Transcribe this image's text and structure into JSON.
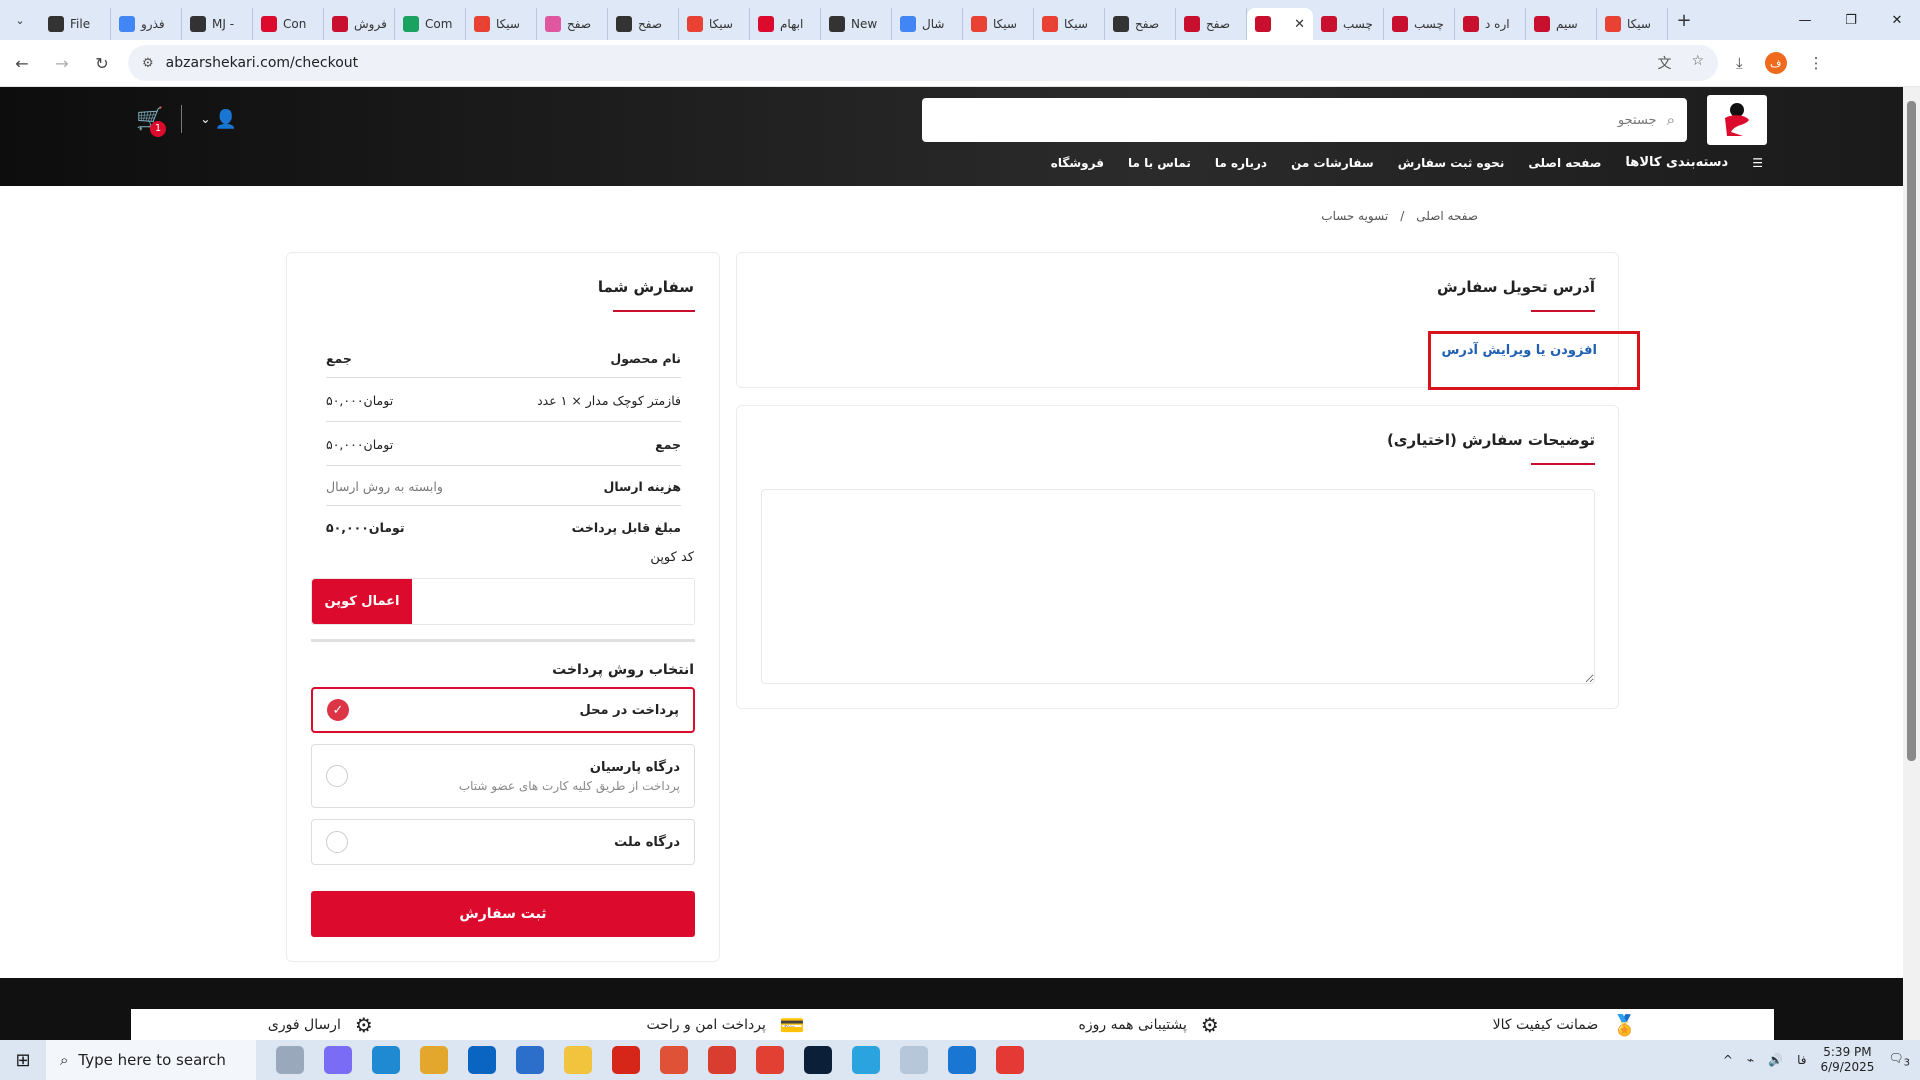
{
  "browser": {
    "tabs": [
      {
        "label": "File",
        "color": "#333333"
      },
      {
        "label": "فذرو",
        "color": "#4285f4"
      },
      {
        "label": "MJ -",
        "color": "#333333"
      },
      {
        "label": "Con",
        "color": "#dc0a2d"
      },
      {
        "label": "فروش",
        "color": "#c8102e"
      },
      {
        "label": "Com",
        "color": "#1aa260"
      },
      {
        "label": "سیکا",
        "color": "#e94235"
      },
      {
        "label": "صفح",
        "color": "#e056a0"
      },
      {
        "label": "صفح",
        "color": "#333333"
      },
      {
        "label": "سیکا",
        "color": "#e94235"
      },
      {
        "label": "ابهام",
        "color": "#dc0a2d"
      },
      {
        "label": "New",
        "color": "#333333"
      },
      {
        "label": "شال",
        "color": "#4285f4"
      },
      {
        "label": "سیکا",
        "color": "#e94235"
      },
      {
        "label": "سیکا",
        "color": "#e94235"
      },
      {
        "label": "صفح",
        "color": "#333333"
      },
      {
        "label": "صفح",
        "color": "#c8102e"
      },
      {
        "label": "",
        "color": "#c8102e",
        "active": true
      },
      {
        "label": "چسب",
        "color": "#c8102e"
      },
      {
        "label": "چسب",
        "color": "#c8102e"
      },
      {
        "label": "اره د",
        "color": "#c8102e"
      },
      {
        "label": "سیم",
        "color": "#c8102e"
      },
      {
        "label": "سیکا",
        "color": "#e94235"
      }
    ],
    "url": "abzarshekari.com/checkout",
    "profile_initial": "ف"
  },
  "site": {
    "search_placeholder": "جستجو",
    "cart_count": "1",
    "menu": {
      "categories": "دسته‌بندی کالاها",
      "items": [
        "صفحه اصلی",
        "نحوه ثبت سفارش",
        "سفارشات من",
        "درباره ما",
        "تماس با ما",
        "فروشگاه"
      ]
    },
    "breadcrumb": {
      "home": "صفحه اصلی",
      "sep": "/",
      "current": "تسویه حساب"
    }
  },
  "address": {
    "title": "آدرس تحویل سفارش",
    "link": "افزودن یا ویرایش آدرس"
  },
  "notes": {
    "title": "توضیحات سفارش (اختیاری)"
  },
  "order": {
    "title": "سفارش شما",
    "header": {
      "product": "نام محصول",
      "total": "جمع"
    },
    "item": {
      "name": "فازمتر کوچک مدار × ۱ عدد",
      "price": "تومان۵۰,۰۰۰"
    },
    "subtotal": {
      "label": "جمع",
      "value": "تومان۵۰,۰۰۰"
    },
    "shipping": {
      "label": "هزینه ارسال",
      "value": "وابسته به روش ارسال"
    },
    "payable": {
      "label": "مبلغ قابل پرداخت",
      "value": "تومان۵۰,۰۰۰"
    },
    "coupon_label": "کد کوپن",
    "coupon_button": "اعمال کوپن",
    "payment_title": "انتخاب روش پرداخت",
    "payment_options": [
      {
        "label": "پرداخت در محل",
        "sub": "",
        "selected": true
      },
      {
        "label": "درگاه پارسیان",
        "sub": "پرداخت از طریق کلیه کارت های عضو شتاب",
        "selected": false
      },
      {
        "label": "درگاه ملت",
        "sub": "",
        "selected": false
      }
    ],
    "submit": "ثبت سفارش"
  },
  "footer": {
    "features": [
      "ضمانت کیفیت کالا",
      "پشتیبانی همه روزه",
      "پرداخت امن و راحت",
      "ارسال فوری"
    ]
  },
  "taskbar": {
    "search_placeholder": "Type here to search",
    "time": "5:39 PM",
    "date": "6/9/2025",
    "lang": "فا",
    "notif_count": "3"
  },
  "colors": {
    "accent": "#dc0a2d",
    "link": "#1f5fb3",
    "header_bg": "#111111"
  }
}
